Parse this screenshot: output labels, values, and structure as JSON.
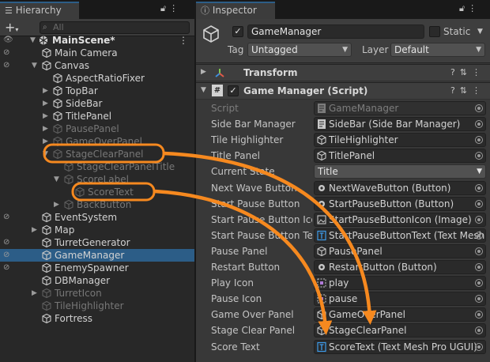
{
  "hierarchy": {
    "tab_label": "Hierarchy",
    "search_placeholder": "All",
    "scene_name": "MainScene*",
    "items": [
      {
        "label": "Main Camera",
        "depth": 1,
        "arrow": "",
        "dim": false,
        "selected": false
      },
      {
        "label": "Canvas",
        "depth": 1,
        "arrow": "down",
        "dim": false,
        "selected": false
      },
      {
        "label": "AspectRatioFixer",
        "depth": 2,
        "arrow": "",
        "dim": false,
        "selected": false
      },
      {
        "label": "TopBar",
        "depth": 2,
        "arrow": "right",
        "dim": false,
        "selected": false
      },
      {
        "label": "SideBar",
        "depth": 2,
        "arrow": "right",
        "dim": false,
        "selected": false
      },
      {
        "label": "TitlePanel",
        "depth": 2,
        "arrow": "right",
        "dim": false,
        "selected": false
      },
      {
        "label": "PausePanel",
        "depth": 2,
        "arrow": "right",
        "dim": true,
        "selected": false
      },
      {
        "label": "GameOverPanel",
        "depth": 2,
        "arrow": "right",
        "dim": true,
        "selected": false
      },
      {
        "label": "StageClearPanel",
        "depth": 2,
        "arrow": "down",
        "dim": true,
        "selected": false
      },
      {
        "label": "StageClearPanelTitle",
        "depth": 3,
        "arrow": "",
        "dim": true,
        "selected": false
      },
      {
        "label": "ScoreLabel",
        "depth": 3,
        "arrow": "down",
        "dim": true,
        "selected": false
      },
      {
        "label": "ScoreText",
        "depth": 4,
        "arrow": "",
        "dim": true,
        "selected": false
      },
      {
        "label": "BackButton",
        "depth": 3,
        "arrow": "right",
        "dim": true,
        "selected": false
      },
      {
        "label": "EventSystem",
        "depth": 1,
        "arrow": "",
        "dim": false,
        "selected": false
      },
      {
        "label": "Map",
        "depth": 1,
        "arrow": "right",
        "dim": false,
        "selected": false
      },
      {
        "label": "TurretGenerator",
        "depth": 1,
        "arrow": "",
        "dim": false,
        "selected": false
      },
      {
        "label": "GameManager",
        "depth": 1,
        "arrow": "",
        "dim": false,
        "selected": true
      },
      {
        "label": "EnemySpawner",
        "depth": 1,
        "arrow": "",
        "dim": false,
        "selected": false
      },
      {
        "label": "DBManager",
        "depth": 1,
        "arrow": "",
        "dim": false,
        "selected": false
      },
      {
        "label": "TurretIcon",
        "depth": 1,
        "arrow": "right",
        "dim": true,
        "selected": false
      },
      {
        "label": "TileHighlighter",
        "depth": 1,
        "arrow": "",
        "dim": true,
        "selected": false
      },
      {
        "label": "Fortress",
        "depth": 1,
        "arrow": "",
        "dim": false,
        "selected": false
      }
    ]
  },
  "inspector": {
    "tab_label": "Inspector",
    "object_name": "GameManager",
    "static_label": "Static",
    "tag_label": "Tag",
    "tag_value": "Untagged",
    "layer_label": "Layer",
    "layer_value": "Default",
    "transform_title": "Transform",
    "script_component_title": "Game Manager (Script)",
    "properties": [
      {
        "label": "Script",
        "value": "GameManager",
        "icon": "script",
        "kind": "ref",
        "disabled": true
      },
      {
        "label": "Side Bar Manager",
        "value": "SideBar (Side Bar Manager)",
        "icon": "script",
        "kind": "ref",
        "disabled": false
      },
      {
        "label": "Tile Highlighter",
        "value": "TileHighlighter",
        "icon": "cube",
        "kind": "ref",
        "disabled": false
      },
      {
        "label": "Title Panel",
        "value": "TitlePanel",
        "icon": "cube",
        "kind": "ref",
        "disabled": false
      },
      {
        "label": "Current State",
        "value": "Title",
        "icon": "",
        "kind": "dropdown",
        "disabled": false
      },
      {
        "label": "Next Wave Button",
        "value": "NextWaveButton (Button)",
        "icon": "button",
        "kind": "ref",
        "disabled": false
      },
      {
        "label": "Start Pause Button",
        "value": "StartPauseButton (Button)",
        "icon": "button",
        "kind": "ref",
        "disabled": false
      },
      {
        "label": "Start Pause Button Icon",
        "value": "StartPauseButtonIcon (Image)",
        "icon": "image",
        "kind": "ref",
        "disabled": false
      },
      {
        "label": "Start Pause Button Text",
        "value": "StartPauseButtonText (Text Mesh Pro UGUI)",
        "icon": "text",
        "kind": "ref",
        "disabled": false
      },
      {
        "label": "Pause Panel",
        "value": "PausePanel",
        "icon": "cube",
        "kind": "ref",
        "disabled": false
      },
      {
        "label": "Restart Button",
        "value": "RestartButton (Button)",
        "icon": "button",
        "kind": "ref",
        "disabled": false
      },
      {
        "label": "Play Icon",
        "value": "play",
        "icon": "sprite",
        "kind": "ref",
        "disabled": false
      },
      {
        "label": "Pause Icon",
        "value": "pause",
        "icon": "sprite",
        "kind": "ref",
        "disabled": false
      },
      {
        "label": "Game Over Panel",
        "value": "GameOverPanel",
        "icon": "cube",
        "kind": "ref",
        "disabled": false
      },
      {
        "label": "Stage Clear Panel",
        "value": "StageClearPanel",
        "icon": "cube",
        "kind": "ref",
        "disabled": false
      },
      {
        "label": "Score Text",
        "value": "ScoreText (Text Mesh Pro UGUI)",
        "icon": "text",
        "kind": "ref",
        "disabled": false
      }
    ]
  },
  "colors": {
    "selection": "#2c5d87",
    "annotation": "#f6891f"
  }
}
